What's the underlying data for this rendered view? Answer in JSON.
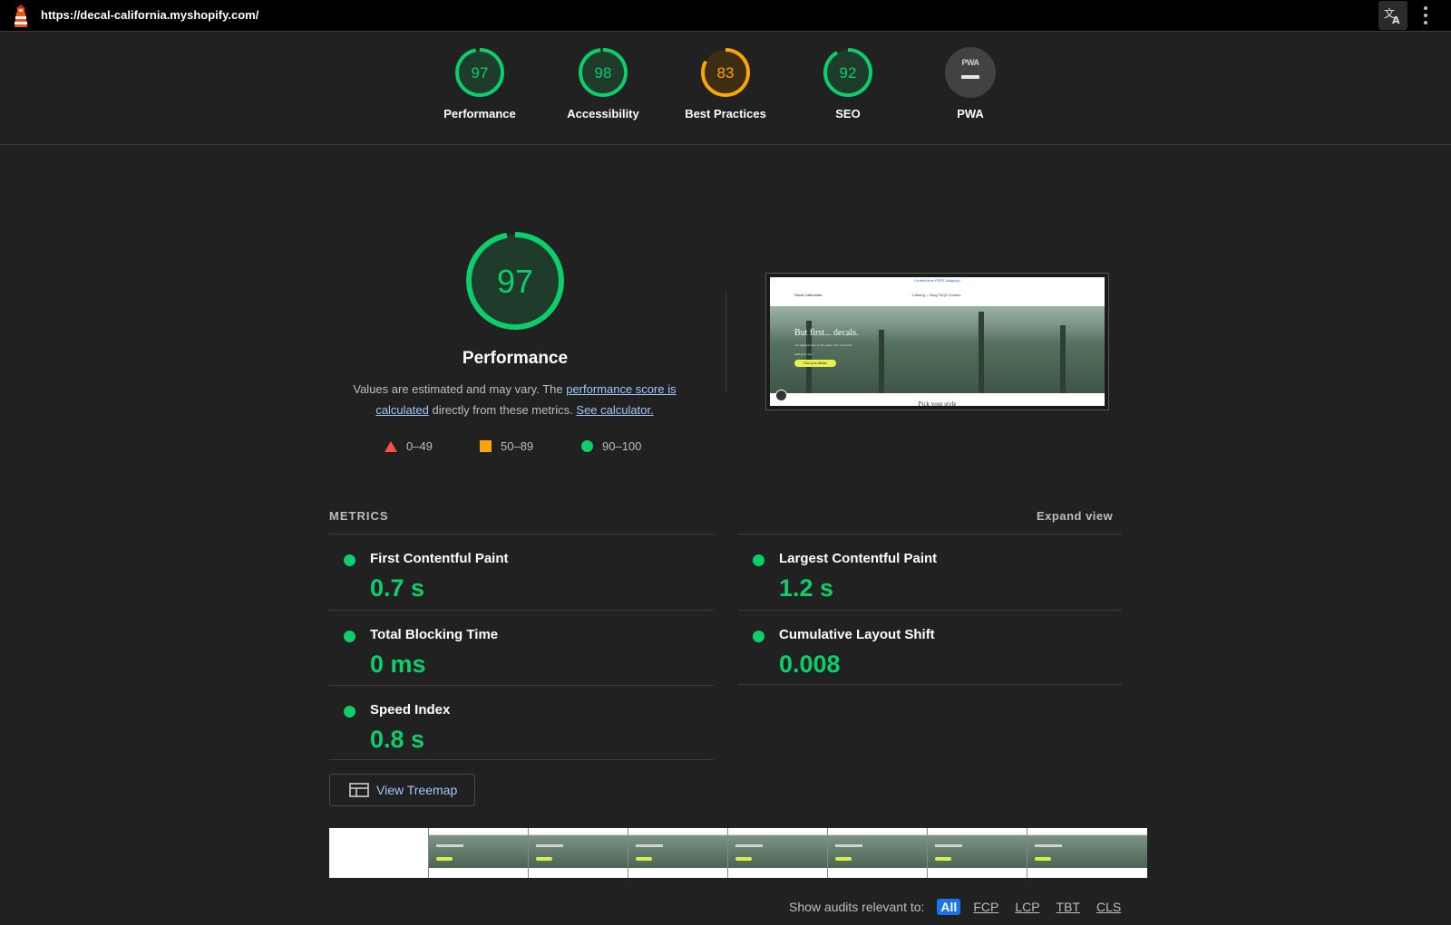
{
  "browser": {
    "url": "https://decal-california.myshopify.com/",
    "logo_icon": "lighthouse-icon",
    "translate_icon": "translate-icon",
    "menu_icon": "kebab-menu-icon"
  },
  "scores": [
    {
      "label": "Performance",
      "value": "97",
      "score": 97,
      "color": "#0cce6b"
    },
    {
      "label": "Accessibility",
      "value": "98",
      "score": 98,
      "color": "#0cce6b"
    },
    {
      "label": "Best Practices",
      "value": "83",
      "score": 83,
      "color": "#ffa400"
    },
    {
      "label": "SEO",
      "value": "92",
      "score": 92,
      "color": "#0cce6b"
    },
    {
      "label": "PWA",
      "badge_text": "PWA"
    }
  ],
  "performance": {
    "score": "97",
    "score_value": 97,
    "title": "Performance",
    "desc_prefix": "Values are estimated and may vary. The ",
    "desc_link1": "performance score is calculated",
    "desc_middle": " directly from these metrics. ",
    "desc_link2": "See calculator.",
    "legend": [
      {
        "range": "0–49",
        "shape": "triangle",
        "color": "#ff4e42"
      },
      {
        "range": "50–89",
        "shape": "square",
        "color": "#ffa400"
      },
      {
        "range": "90–100",
        "shape": "circle",
        "color": "#0cce6b"
      }
    ]
  },
  "final_screenshot": {
    "announcement": "Limited time FREE shipping!",
    "brand": "Decal Californian",
    "nav_links": "Catalog ⌄     Blog     FAQs     Contact",
    "headline": "But first... decals.",
    "subtext": "The happiest time on the roads. Your 4 are buzz waiting for you",
    "button": "Find your sticker",
    "footer_heading": "Pick your style"
  },
  "metrics": {
    "section_title": "METRICS",
    "expand_label": "Expand view",
    "items": [
      {
        "title": "First Contentful Paint",
        "value": "0.7 s"
      },
      {
        "title": "Largest Contentful Paint",
        "value": "1.2 s"
      },
      {
        "title": "Total Blocking Time",
        "value": "0 ms"
      },
      {
        "title": "Cumulative Layout Shift",
        "value": "0.008"
      },
      {
        "title": "Speed Index",
        "value": "0.8 s"
      }
    ],
    "status_color": "#0cce6b"
  },
  "treemap": {
    "label": "View Treemap",
    "icon": "treemap-icon"
  },
  "filter": {
    "label": "Show audits relevant to:",
    "chips": [
      "All",
      "FCP",
      "LCP",
      "TBT",
      "CLS"
    ],
    "active": "All"
  }
}
